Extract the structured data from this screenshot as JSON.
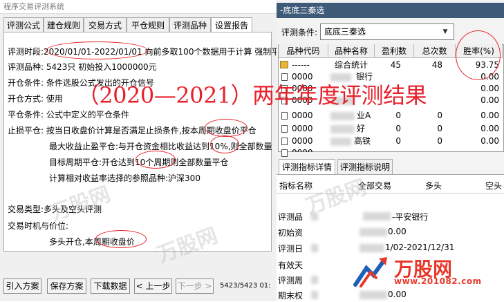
{
  "left_window": {
    "title": "程序交易评测系统",
    "tabs": [
      "评测公式",
      "建仓规则",
      "交易方式",
      "平仓规则",
      "评测品种",
      "设置报告"
    ],
    "lines": {
      "period_label": "评测时段:",
      "period_value": "2020/01/01-2022/01/01",
      "period_tail": "向前多取100个数据用于计算 强制平",
      "product_label": "评测品种:",
      "product_value": "5423只 初始投入1000000元",
      "open_label": "开仓条件:",
      "open_value": "条件选股公式发出的开仓信号",
      "mode_label": "开仓方式:",
      "mode_value": "使用",
      "close_label": "平仓条件:",
      "close_value": "公式中定义的平仓条件",
      "stop_label": "止损平仓:",
      "stop_value": "按当日收盘价计算是否满足止损条件,按本周期收盘价平仓",
      "maxprofit": "最大收益止盈平仓:与开仓资金相比收益达到10%,则全部数量",
      "target": "目标周期平仓:开仓达到10个周期则全部数量平仓",
      "benchmark": "计算相对收益率选择的参照品种:沪深300",
      "trade_type": "交易类型:多头及空头评测",
      "trade_time": "交易时机与价位:",
      "trade_price": "多头开仓,本周期收盘价"
    },
    "buttons": [
      "引入方案",
      "保存方案",
      "下载数据",
      "< 上一步",
      "下一步 >"
    ],
    "status": "5423/5423 01:"
  },
  "right_window": {
    "title": "-底底三秦选",
    "condition_label": "评测条件:",
    "condition_value": "底底三秦选",
    "columns": [
      "品种代码",
      "品种名称",
      "盈利数",
      "总次数",
      "胜率(%)"
    ],
    "summary_row": {
      "code": "------",
      "name": "综合统计",
      "profit": "45",
      "total": "48",
      "rate": "93.75"
    },
    "rows": [
      {
        "code": "0000",
        "name": "银行",
        "profit": "0",
        "total": "0",
        "rate": "0.00"
      },
      {
        "code": "0000",
        "name": "",
        "profit": "0",
        "total": "0",
        "rate": "0.00"
      },
      {
        "code": "0000",
        "name": "",
        "profit": "0",
        "total": "0",
        "rate": "0.00"
      },
      {
        "code": "0000",
        "name": "业A",
        "profit": "0",
        "total": "0",
        "rate": "0.00"
      },
      {
        "code": "0000",
        "name": "好",
        "profit": "0",
        "total": "0",
        "rate": "0.00"
      },
      {
        "code": "0000",
        "name": "高铁",
        "profit": "0",
        "total": "0",
        "rate": "0.00"
      },
      {
        "code": "0000",
        "name": "",
        "profit": "0",
        "total": "0",
        "rate": "0.00"
      }
    ],
    "detail_tabs": [
      "评测指标详情",
      "评测指标说明"
    ],
    "detail_headers": [
      "指标名称",
      "全部交易",
      "多头",
      "空头"
    ],
    "detail_rows": [
      {
        "name": "评测品",
        "value": "-平安银行"
      },
      {
        "name": "初始资",
        "value": "0.00"
      },
      {
        "name": "评测日",
        "value": "1/02-2021/12/31"
      },
      {
        "name": "有效天",
        "value": ""
      },
      {
        "name": "评测周",
        "value": ""
      },
      {
        "name": "期末权",
        "value": "0.00"
      }
    ]
  },
  "overlay": {
    "heading": "（2020—2021）两年年度评测结果",
    "accent_color": "#e8202a"
  },
  "watermark": {
    "logo_text": "万股网",
    "logo_url": "www.201082.com",
    "repeat_text": "万股网"
  }
}
